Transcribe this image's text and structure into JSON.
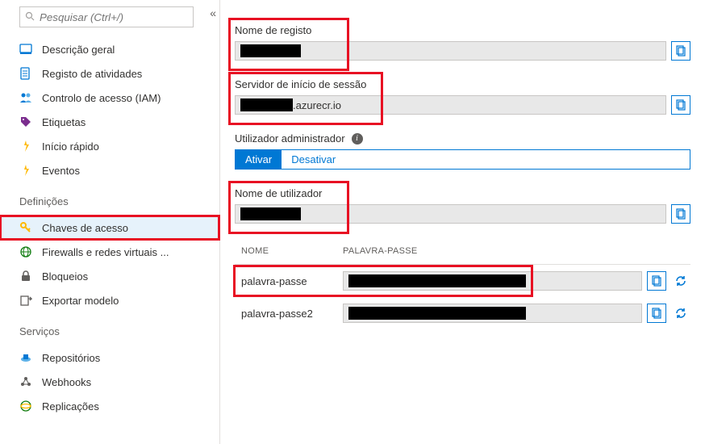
{
  "search": {
    "placeholder": "Pesquisar (Ctrl+/)"
  },
  "sidebar": {
    "items": [
      {
        "label": "Descrição geral",
        "icon": "overview"
      },
      {
        "label": "Registo de atividades",
        "icon": "activity"
      },
      {
        "label": "Controlo de acesso (IAM)",
        "icon": "iam"
      },
      {
        "label": "Etiquetas",
        "icon": "tag"
      },
      {
        "label": "Início rápido",
        "icon": "quickstart"
      },
      {
        "label": "Eventos",
        "icon": "events"
      }
    ],
    "section1": "Definições",
    "settings": [
      {
        "label": "Chaves de acesso",
        "icon": "key",
        "active": true
      },
      {
        "label": "Firewalls e redes virtuais ...",
        "icon": "firewall"
      },
      {
        "label": "Bloqueios",
        "icon": "lock"
      },
      {
        "label": "Exportar modelo",
        "icon": "export"
      }
    ],
    "section2": "Serviços",
    "services": [
      {
        "label": "Repositórios",
        "icon": "repos"
      },
      {
        "label": "Webhooks",
        "icon": "webhooks"
      },
      {
        "label": "Replicações",
        "icon": "replications"
      }
    ]
  },
  "main": {
    "registry_name_label": "Nome de registo",
    "registry_name_value": "████████",
    "login_server_label": "Servidor de início de sessão",
    "login_server_suffix": ".azurecr.io",
    "admin_user_label": "Utilizador administrador",
    "toggle_on": "Ativar",
    "toggle_off": "Desativar",
    "username_label": "Nome de utilizador",
    "username_value": "████████",
    "pw_col_name": "NOME",
    "pw_col_value": "PALAVRA-PASSE",
    "passwords": [
      {
        "name": "palavra-passe"
      },
      {
        "name": "palavra-passe2"
      }
    ]
  }
}
